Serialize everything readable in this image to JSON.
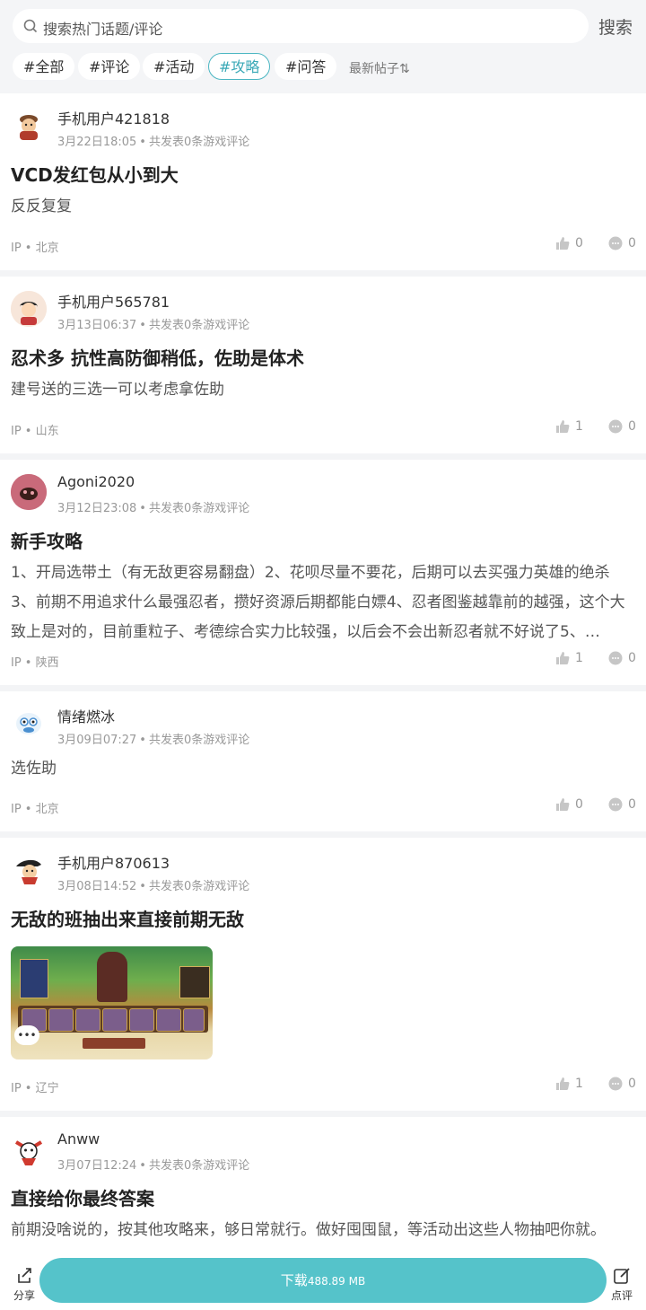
{
  "search": {
    "placeholder": "搜索热门话题/评论",
    "button": "搜索"
  },
  "tags": [
    "#全部",
    "#评论",
    "#活动",
    "#攻略",
    "#问答"
  ],
  "active_tag": "#攻略",
  "sort_label": "最新帖子⇅",
  "posts": [
    {
      "user": "手机用户421818",
      "date": "3月22日18:05",
      "meta_tail": "共发表0条游戏评论",
      "title": "VCD发红包从小到大",
      "body": "反反复复",
      "ip": "IP • 北京",
      "likes": "0",
      "comments": "0"
    },
    {
      "user": "手机用户565781",
      "date": "3月13日06:37",
      "meta_tail": "共发表0条游戏评论",
      "title": "忍术多 抗性高防御稍低，佐助是体术",
      "body": "建号送的三选一可以考虑拿佐助",
      "ip": "IP • 山东",
      "likes": "1",
      "comments": "0"
    },
    {
      "user": "Agoni2020",
      "date": "3月12日23:08",
      "meta_tail": "共发表0条游戏评论",
      "title": "新手攻略",
      "body": "1、开局选带土（有无敌更容易翻盘）2、花呗尽量不要花，后期可以去买强力英雄的绝杀3、前期不用追求什么最强忍者，攒好资源后期都能白嫖4、忍者图鉴越靠前的越强，这个大致上是对的，目前重粒子、考德综合实力比较强，以后会不会出新忍者就不好说了5、…",
      "ip": "IP • 陕西",
      "likes": "1",
      "comments": "0"
    },
    {
      "user": "情绪燃冰",
      "date": "3月09日07:27",
      "meta_tail": "共发表0条游戏评论",
      "title": "",
      "body": "选佐助",
      "ip": "IP • 北京",
      "likes": "0",
      "comments": "0"
    },
    {
      "user": "手机用户870613",
      "date": "3月08日14:52",
      "meta_tail": "共发表0条游戏评论",
      "title": "无敌的班抽出来直接前期无敌",
      "body": "",
      "ip": "IP • 辽宁",
      "likes": "1",
      "comments": "0"
    },
    {
      "user": "Anww",
      "date": "3月07日12:24",
      "meta_tail": "共发表0条游戏评论",
      "title": "直接给你最终答案",
      "body": "前期没啥说的，按其他攻略来，够日常就行。做好囤囤鼠，等活动出这些人物抽吧你就。",
      "ip": "",
      "likes": "",
      "comments": ""
    }
  ],
  "bottom": {
    "share": "分享",
    "download": "下载",
    "size": "488.89 MB",
    "review": "点评"
  },
  "colors": {
    "accent": "#55c3ca",
    "active_tag": "#3aa9b7"
  }
}
